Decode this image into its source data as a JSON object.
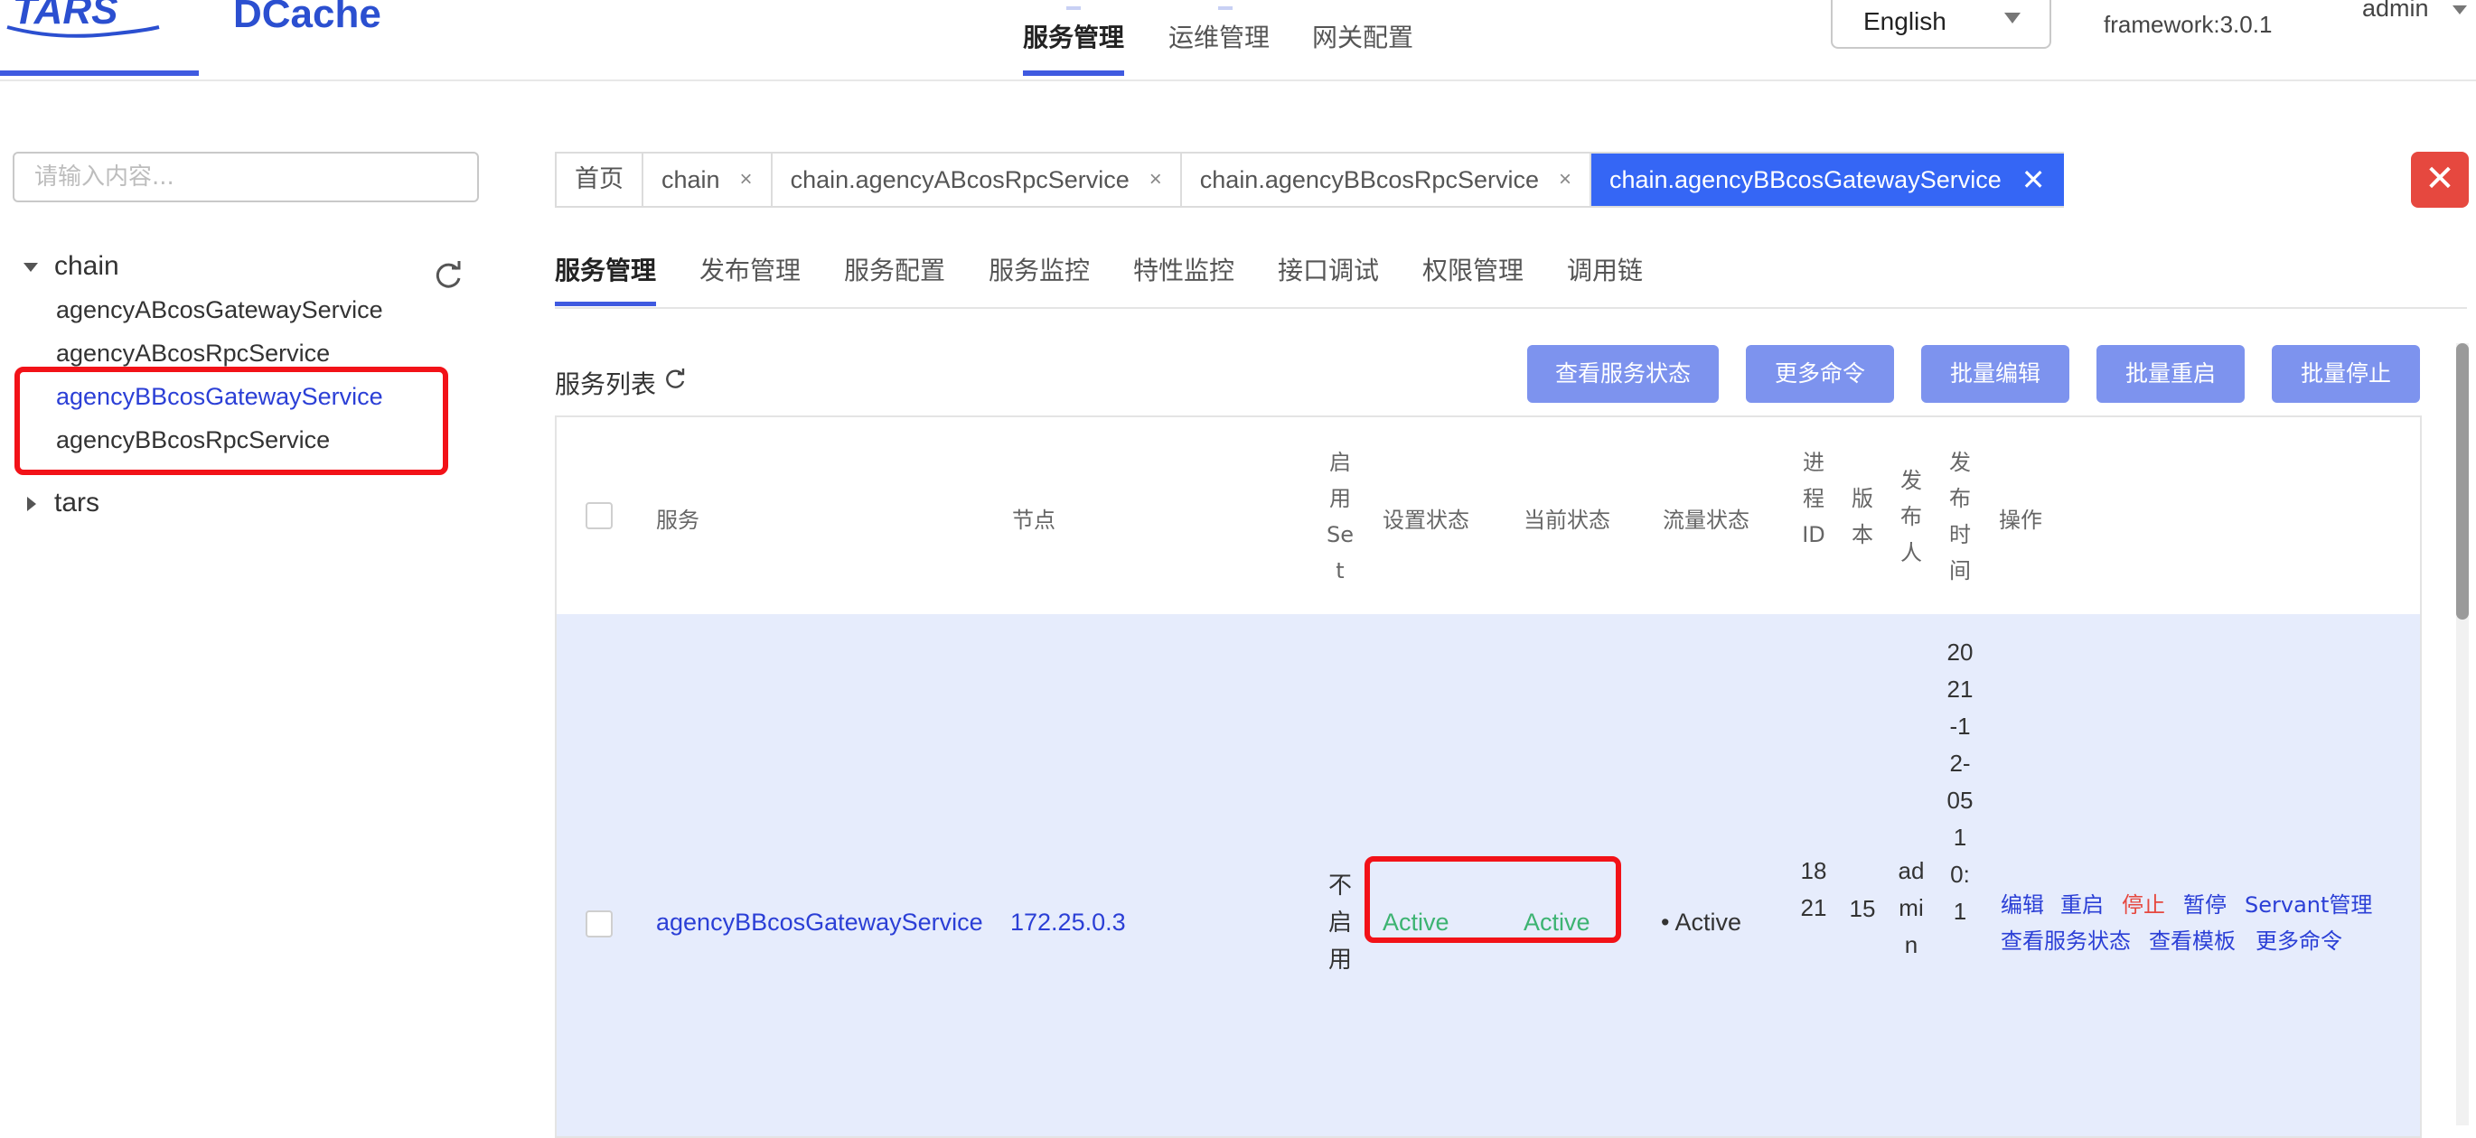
{
  "header": {
    "logo_tars": "TARS",
    "logo_dcache": "DCache",
    "nav": [
      "服务管理",
      "运维管理",
      "网关配置"
    ],
    "language": "English",
    "framework": "framework:3.0.1",
    "user": "admin"
  },
  "sidebar": {
    "search_placeholder": "请输入内容...",
    "tree": [
      {
        "label": "chain",
        "expanded": true,
        "children": [
          {
            "label": "agencyABcosGatewayService"
          },
          {
            "label": "agencyABcosRpcService"
          },
          {
            "label": "agencyBBcosGatewayService",
            "selected": true
          },
          {
            "label": "agencyBBcosRpcService"
          }
        ]
      },
      {
        "label": "tars",
        "expanded": false
      }
    ]
  },
  "tabs": [
    {
      "label": "首页"
    },
    {
      "label": "chain",
      "close": "×"
    },
    {
      "label": "chain.agencyABcosRpcService",
      "close": "×"
    },
    {
      "label": "chain.agencyBBcosRpcService",
      "close": "×"
    },
    {
      "label": "chain.agencyBBcosGatewayService",
      "close": "✕",
      "active": true
    }
  ],
  "close_all": "✕",
  "subtabs": [
    "服务管理",
    "发布管理",
    "服务配置",
    "服务监控",
    "特性监控",
    "接口调试",
    "权限管理",
    "调用链"
  ],
  "service_list": {
    "title": "服务列表",
    "buttons": [
      "查看服务状态",
      "更多命令",
      "批量编辑",
      "批量重启",
      "批量停止"
    ]
  },
  "table": {
    "headers": {
      "service": "服务",
      "node": "节点",
      "enable_set": "启用Set",
      "set_status": "设置状态",
      "current_status": "当前状态",
      "traffic_status": "流量状态",
      "pid": "进程ID",
      "version": "版本",
      "publisher": "发布人",
      "publish_time": "发布时间",
      "ops": "操作"
    },
    "rows": [
      {
        "service": "agencyBBcosGatewayService",
        "node": "172.25.0.3",
        "enable_set": "不启用",
        "set_status": "Active",
        "current_status": "Active",
        "traffic_status": "• Active",
        "pid": "1821",
        "version": "15",
        "publisher": "admin",
        "publish_time": "2021-12-0510:1",
        "ops_line1": [
          "编辑",
          "重启",
          "停止",
          "暂停",
          "Servant管理"
        ],
        "ops_line2": [
          "查看服务状态",
          "查看模板",
          "更多命令"
        ]
      }
    ]
  },
  "colors": {
    "accent": "#3f5ae0",
    "tab_active": "#3566f5",
    "button": "#7d93ee",
    "active_status": "#3cb371",
    "danger": "#e6483f",
    "annotation": "#f21218"
  }
}
